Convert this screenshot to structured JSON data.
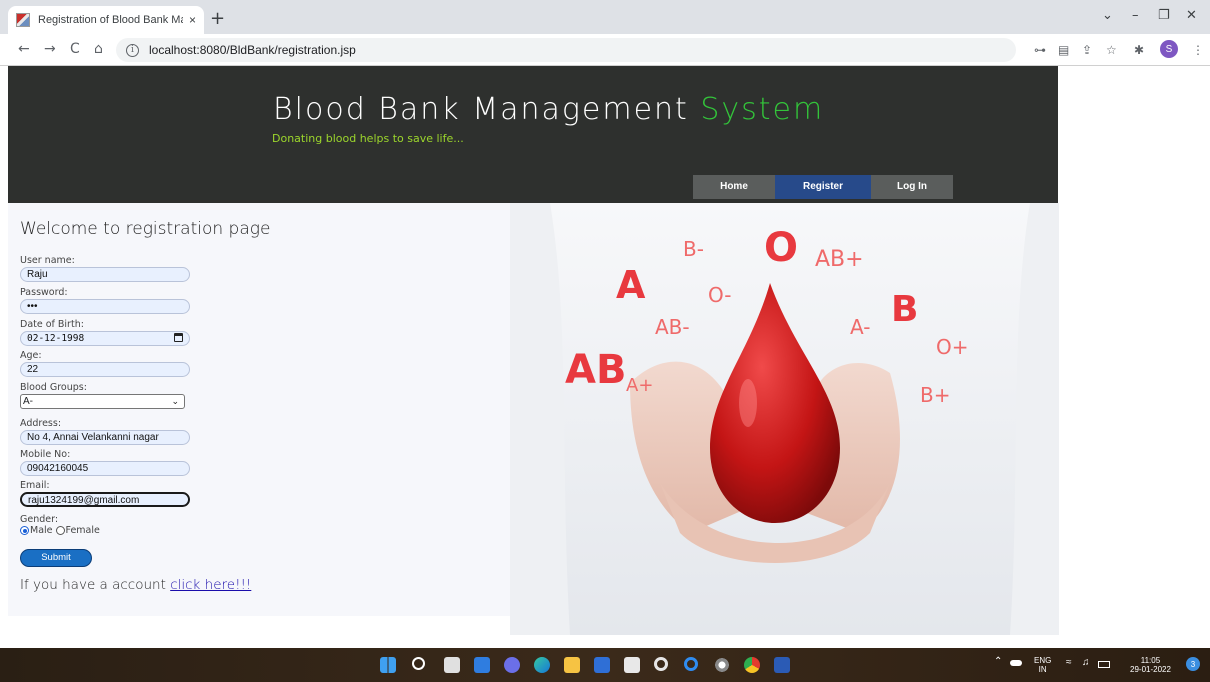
{
  "browser": {
    "tab_title": "Registration of Blood Bank Mana",
    "tab_close": "×",
    "new_tab": "+",
    "url": "localhost:8080/BldBank/registration.jsp",
    "nav_back": "←",
    "nav_forward": "→",
    "nav_reload": "C",
    "nav_home": "⌂",
    "info_glyph": "i",
    "profile_initial": "S",
    "win_dropdown": "⌄",
    "win_minimize": "–",
    "win_restore": "❐",
    "win_close": "✕",
    "ext_key": "⊶",
    "ext_translate": "▤",
    "ext_share": "⇪",
    "ext_bookmark": "☆",
    "ext_puzzle": "✱",
    "ext_menu": "⋮"
  },
  "header": {
    "title_main": "Blood Bank Management ",
    "title_accent": "System",
    "tagline": "Donating blood helps to save life...",
    "menu": {
      "home": "Home",
      "register": "Register",
      "login": "Log In"
    }
  },
  "form": {
    "heading": "Welcome to registration page",
    "username_label": "User name:",
    "username_value": "Raju",
    "password_label": "Password:",
    "password_value": "•••",
    "dob_label": "Date of Birth:",
    "dob_value": "02-12-1998",
    "age_label": "Age:",
    "age_value": "22",
    "blood_label": "Blood Groups:",
    "blood_value": "A-",
    "address_label": "Address:",
    "address_value": "No 4, Annai Velankanni nagar",
    "mobile_label": "Mobile No:",
    "mobile_value": "09042160045",
    "email_label": "Email:",
    "email_value": "raju1324199@gmail.com",
    "gender_label": "Gender:",
    "gender_male": "Male",
    "gender_female": "Female",
    "gender_selected": "Male",
    "submit_label": "Submit",
    "account_text": "If you have a account ",
    "account_link": "click here!!!"
  },
  "hero": {
    "groups": [
      "B-",
      "O",
      "AB+",
      "A",
      "O-",
      "B",
      "AB-",
      "A-",
      "O+",
      "AB",
      "A+",
      "B+"
    ]
  },
  "taskbar": {
    "lang_top": "ENG",
    "lang_bottom": "IN",
    "time": "11:05",
    "date": "29-01-2022",
    "notifications": "3"
  },
  "colors": {
    "header_bg": "#2e302e",
    "title_accent": "#33c43a",
    "tagline": "#9cd62c",
    "menu_active": "#274a8a",
    "menu_inactive": "#5a5d5c",
    "blood_red": "#e8393f",
    "submit_bg": "#1a6fc4"
  }
}
